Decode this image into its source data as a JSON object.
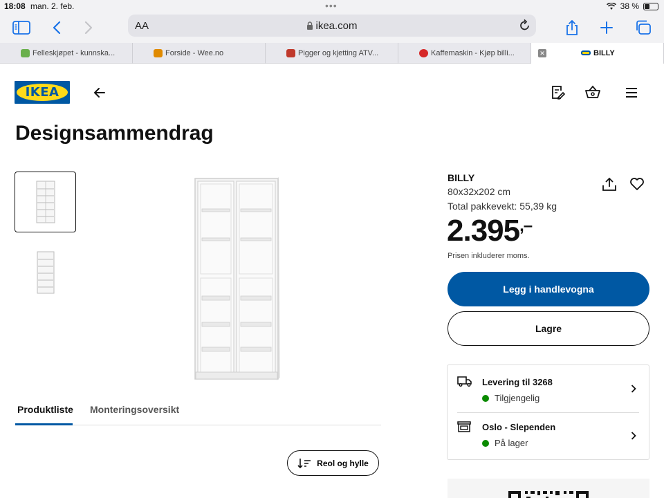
{
  "status_bar": {
    "time": "18:08",
    "date": "man. 2. feb.",
    "battery": "38 %",
    "battery_level": 0.38
  },
  "browser": {
    "text_size_label": "AA",
    "url": "ikea.com",
    "tabs": [
      {
        "label": "Felleskjøpet - kunnska...",
        "color": "#6ab04c"
      },
      {
        "label": "Forside - Wee.no",
        "color": "#e08a00"
      },
      {
        "label": "Pigger og kjetting ATV...",
        "color": "#c0392b"
      },
      {
        "label": "Kaffemaskin - Kjøp billi...",
        "color": "#d62828"
      },
      {
        "label": "BILLY",
        "color": "#f5d300",
        "active": true
      }
    ]
  },
  "header": {
    "logo_text": "IKEA"
  },
  "page": {
    "title": "Designsammendrag"
  },
  "product": {
    "name": "BILLY",
    "dimensions": "80x32x202 cm",
    "package_weight": "Total pakkevekt: 55,39 kg",
    "price": "2.395",
    "price_suffix": ",–",
    "vat_note": "Prisen inkluderer moms.",
    "add_to_cart_label": "Legg i handlevogna",
    "save_label": "Lagre"
  },
  "availability": {
    "delivery_title": "Levering til 3268",
    "delivery_status": "Tilgjengelig",
    "store_title": "Oslo - Slependen",
    "store_status": "På lager",
    "status_color": "#0a8a00"
  },
  "product_tabs": {
    "active": "Produktliste",
    "other": "Monteringsoversikt"
  },
  "filter_button": {
    "label": "Reol og hylle"
  },
  "colors": {
    "brand_blue": "#0058a3",
    "brand_yellow": "#ffda1a"
  }
}
